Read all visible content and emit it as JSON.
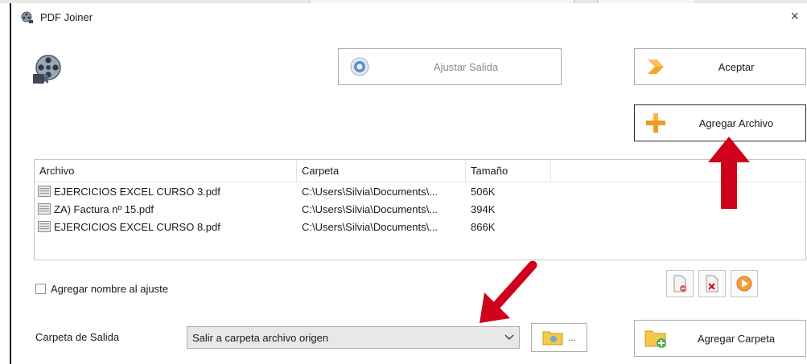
{
  "window": {
    "title": "PDF Joiner",
    "close_glyph": "×"
  },
  "toolbar": {
    "ajustar_label": "Ajustar Salida",
    "aceptar_label": "Aceptar",
    "agregar_archivo_label": "Agregar Archivo",
    "agregar_carpeta_label": "Agregar Carpeta"
  },
  "file_list": {
    "columns": [
      "Archivo",
      "Carpeta",
      "Tamaño",
      ""
    ],
    "rows": [
      {
        "archivo": "EJERCICIOS EXCEL CURSO 3.pdf",
        "carpeta": "C:\\Users\\Silvia\\Documents\\...",
        "tamano": "506K"
      },
      {
        "archivo": "ZA) Factura nº 15.pdf",
        "carpeta": "C:\\Users\\Silvia\\Documents\\...",
        "tamano": "394K"
      },
      {
        "archivo": "EJERCICIOS EXCEL CURSO 8.pdf",
        "carpeta": "C:\\Users\\Silvia\\Documents\\...",
        "tamano": "866K"
      }
    ]
  },
  "options": {
    "agregar_nombre_label": "Agregar nombre al ajuste",
    "agregar_nombre_checked": false
  },
  "output": {
    "carpeta_label": "Carpeta de Salida",
    "selected": "Salir a carpeta archivo origen",
    "browse_dots": "..."
  },
  "colors": {
    "arrow_red": "#d0021b",
    "plus_orange": "#f29a1f",
    "arrow_orange": "#f5a623",
    "folder_yellow": "#f3c94b"
  },
  "icons": {
    "app": "film-reel-icon",
    "logo": "film-reel-camera-icon",
    "ajustar": "gear-circle-icon",
    "aceptar": "orange-arrow-icon",
    "agregar_archivo": "orange-plus-icon",
    "agregar_carpeta": "folder-plus-icon",
    "browse": "folder-icon"
  }
}
